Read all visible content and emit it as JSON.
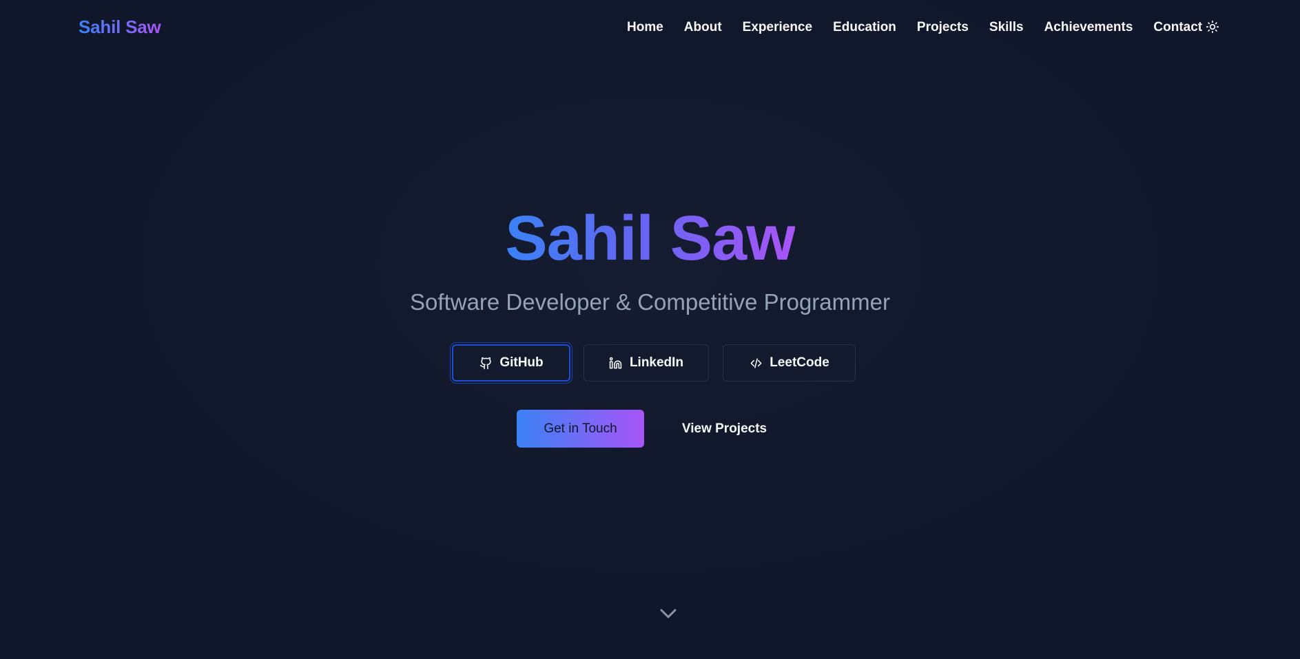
{
  "navbar": {
    "brand": "Sahil Saw",
    "links": [
      "Home",
      "About",
      "Experience",
      "Education",
      "Projects",
      "Skills",
      "Achievements",
      "Contact"
    ],
    "theme_icon": "sun-icon"
  },
  "hero": {
    "name": "Sahil Saw",
    "subtitle": "Software Developer & Competitive Programmer",
    "social": [
      {
        "label": "GitHub",
        "icon": "github-icon"
      },
      {
        "label": "LinkedIn",
        "icon": "linkedin-icon"
      },
      {
        "label": "LeetCode",
        "icon": "code-icon"
      }
    ],
    "cta_primary": "Get in Touch",
    "cta_secondary": "View Projects",
    "scroll_icon": "chevron-down-icon"
  },
  "colors": {
    "background": "#11172a",
    "accent_start": "#3b82f6",
    "accent_end": "#a855f7",
    "muted_text": "#94a3b8",
    "focus_ring": "#1d4ed8"
  }
}
